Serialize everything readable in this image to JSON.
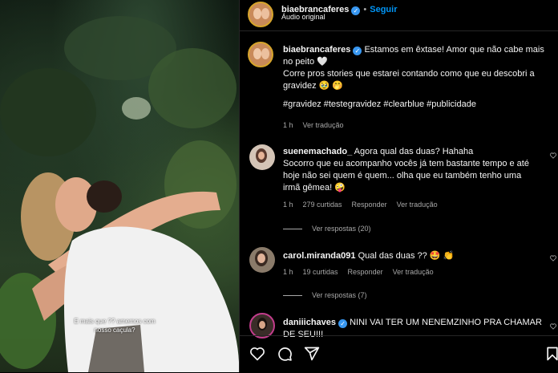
{
  "media": {
    "caption": "E mais que ?? amemos com nosso caçula?"
  },
  "header": {
    "username": "biaebrancaferes",
    "separator": "•",
    "follow_label": "Seguir",
    "audio_label": "Áudio original"
  },
  "post": {
    "username": "biaebrancaferes",
    "line1": "Estamos em êxtase! Amor que não cabe mais",
    "line2": "no peito 🤍",
    "line3": "Corre pros stories que estarei contando como que eu descobri a",
    "line4": "gravidez 🥹 🤭",
    "hashtags": "#gravidez #testegravidez #clearblue #publicidade",
    "time": "1 h",
    "translate_label": "Ver tradução"
  },
  "comments": [
    {
      "username": "suenemachado_",
      "first_line": "Agora qual das duas? Hahaha",
      "line2": "Socorro que eu acompanho vocês já tem bastante tempo e até",
      "line3": "hoje não sei quem é quem... olha que eu também tenho uma",
      "line4": "irmã gêmea! 🤪",
      "time": "1 h",
      "likes": "279 curtidas",
      "reply_label": "Responder",
      "translate_label": "Ver tradução",
      "replies_label": "Ver respostas (20)"
    },
    {
      "username": "carol.miranda091",
      "first_line": "Qual das duas ?? 🤩 👏",
      "time": "1 h",
      "likes": "19 curtidas",
      "reply_label": "Responder",
      "translate_label": "Ver tradução",
      "replies_label": "Ver respostas (7)"
    },
    {
      "username": "daniiichaves",
      "first_line": "NINI VAI TER UM NENEMZINHO PRA CHAMAR",
      "line2": "DE SEU!!!"
    }
  ],
  "icons": {
    "like": "heart-icon",
    "comment": "comment-icon",
    "share": "share-icon",
    "save": "bookmark-icon"
  }
}
